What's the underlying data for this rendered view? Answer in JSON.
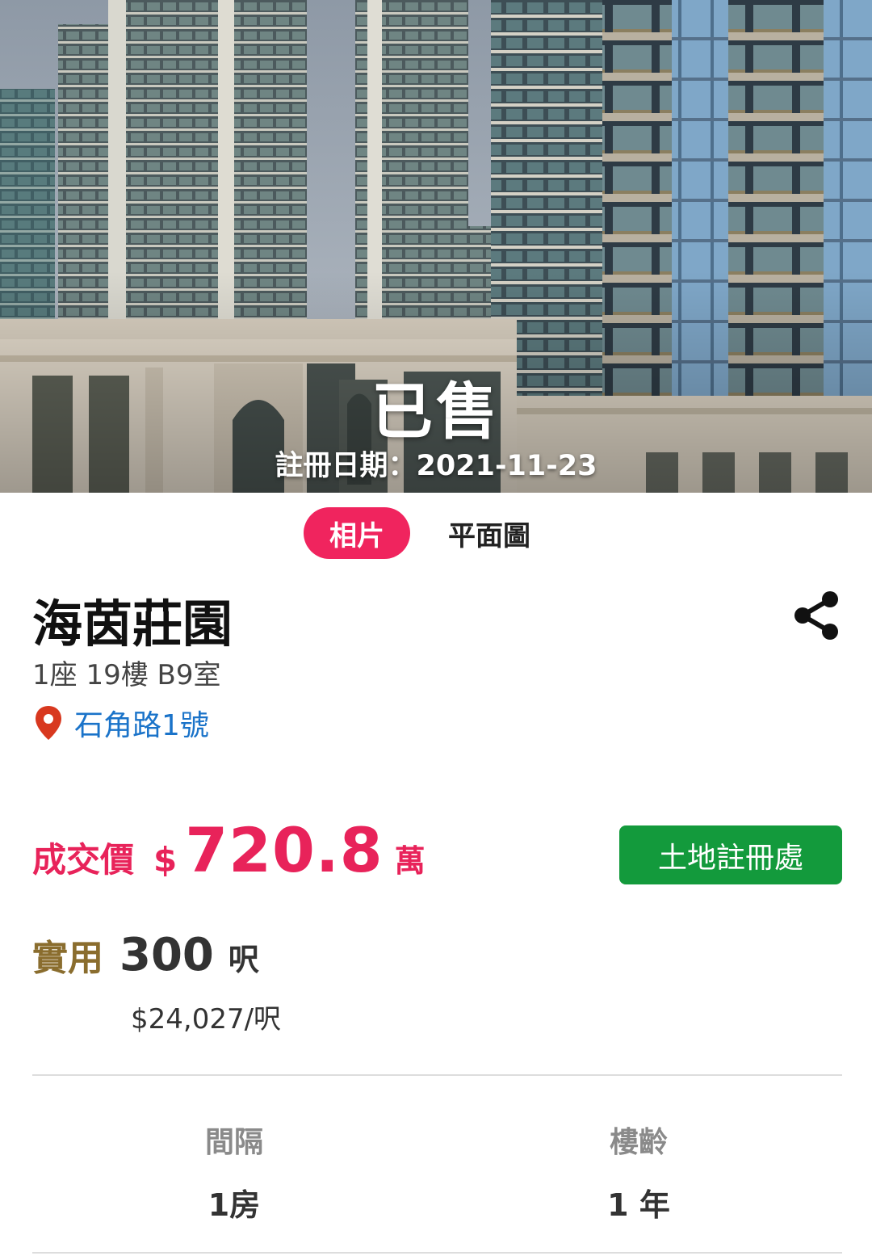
{
  "hero": {
    "status": "已售",
    "registration_date": "註冊日期：2021-11-23"
  },
  "media_tabs": {
    "photo": "相片",
    "floor_plan": "平面圖",
    "active": "photo",
    "active_color": "#f0245e"
  },
  "listing": {
    "estate_name": "海茵莊園",
    "unit": "1座 19樓 B9室",
    "address": "石角路1號",
    "price_label": "成交價",
    "currency": "$",
    "price": "720.8",
    "price_unit": "萬",
    "land_registry_button": "土地註冊處",
    "area_label": "實用",
    "area": "300",
    "area_unit": "呎",
    "unit_price": "$24,027/呎"
  },
  "stats": [
    {
      "label": "間隔",
      "value": "1房"
    },
    {
      "label": "樓齡",
      "value": "1 年"
    }
  ],
  "icons": {
    "share": "share-icon",
    "location": "location-pin-icon"
  },
  "colors": {
    "price": "#e8235a",
    "area_label": "#8a6d2e",
    "link": "#1a73c9",
    "land_registry": "#139a3c"
  }
}
